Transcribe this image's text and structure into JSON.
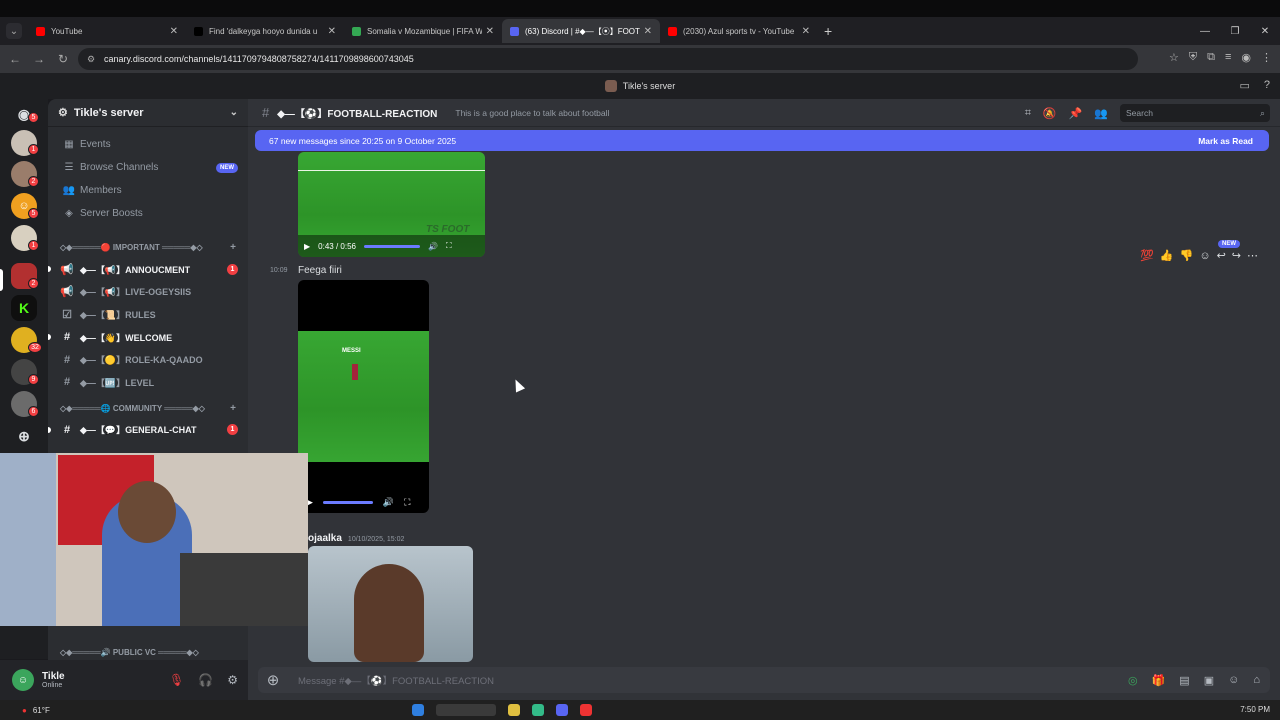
{
  "browser": {
    "tabs": [
      {
        "title": "YouTube",
        "color": "#ff0000"
      },
      {
        "title": "Find 'dalkeyga hooyo dunida u",
        "color": "#000000"
      },
      {
        "title": "Somalia v Mozambique | FIFA W",
        "color": "#34a853"
      },
      {
        "title": "(63) Discord | #◆—【⦿】FOOTB",
        "color": "#5865f2",
        "active": true
      },
      {
        "title": "(2030) Azul sports tv - YouTube",
        "color": "#ff0000"
      }
    ],
    "url": "canary.discord.com/channels/1411709794808758274/1411709898600743045"
  },
  "discord": {
    "top_server_label": "Tikle's server",
    "server_name": "Tikle's server",
    "nav": [
      {
        "label": "Events",
        "icon": "calendar-icon"
      },
      {
        "label": "Browse Channels",
        "icon": "browse-icon",
        "badge": "NEW"
      },
      {
        "label": "Members",
        "icon": "members-icon"
      },
      {
        "label": "Server Boosts",
        "icon": "boost-icon"
      }
    ],
    "categories": [
      {
        "label": "◇◆═════🔴 IMPORTANT ═════◆◇",
        "channels": [
          {
            "icon": "📢",
            "name": "◆—【📢】ANNOUCMENT",
            "unread": true,
            "mentions": "1"
          },
          {
            "icon": "📢",
            "name": "◆—【📢】LIVE-OGEYSIIS"
          },
          {
            "icon": "☑",
            "name": "◆—【📜】RULES"
          },
          {
            "icon": "#",
            "name": "◆—【👋】WELCOME",
            "unread": true
          },
          {
            "icon": "#",
            "name": "◆—【🟡】ROLE-KA-QAADO"
          },
          {
            "icon": "#",
            "name": "◆—【🆙】LEVEL"
          }
        ]
      },
      {
        "label": "◇◆═════🌐 COMMUNITY ═════◆◇",
        "channels": [
          {
            "icon": "#",
            "name": "◆—【💬】GENERAL-CHAT",
            "unread": true,
            "mentions": "1"
          }
        ]
      }
    ],
    "voice_category": "◇◆═════🔊 PUBLIC VC ═════◆◇",
    "guild_badges": [
      "5",
      "1",
      "2",
      "5",
      "1",
      "2",
      "32",
      "9",
      "6"
    ],
    "user": {
      "name": "Tikle",
      "status": "Online"
    },
    "channel": {
      "name": "◆—【⚽】FOOTBALL-REACTION",
      "topic": "This is a good place to talk about football",
      "search_placeholder": "Search"
    },
    "new_messages": {
      "text": "67 new messages since 20:25 on 9 October 2025",
      "action": "Mark as Read"
    },
    "video1": {
      "time": "0:43 / 0:56",
      "watermark": "TS FOOT"
    },
    "message2": {
      "time": "10:09",
      "text": "Feega fiiri",
      "overlay": "MESSI"
    },
    "message3": {
      "author": "ojaalka",
      "timestamp": "10/10/2025, 15:02"
    },
    "new_label": "NEW",
    "composer_placeholder": "Message #◆—【⚽】FOOTBALL-REACTION"
  },
  "taskbar": {
    "weather": "61°F",
    "clock": "7:50 PM"
  }
}
